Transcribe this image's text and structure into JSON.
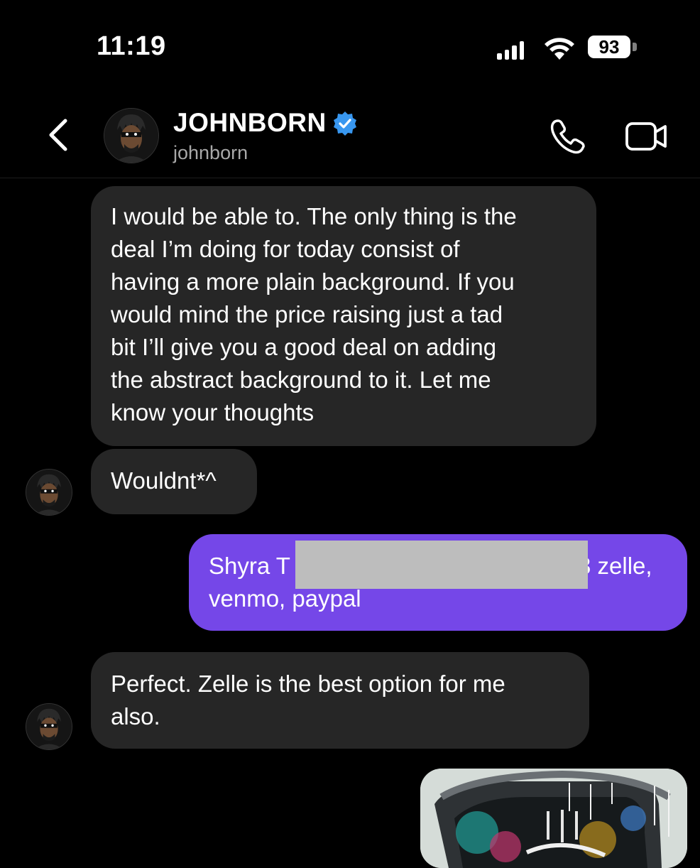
{
  "status_bar": {
    "time": "11:19",
    "battery": "93"
  },
  "header": {
    "name": "JOHNBORN",
    "handle": "johnborn",
    "icons": [
      "chevron-left-icon",
      "verified-badge-icon",
      "phone-icon",
      "video-camera-icon"
    ]
  },
  "messages": [
    {
      "from": "johnborn",
      "text": "I would be able to. The only thing is the\ndeal I’m doing for today consist of\nhaving a more plain background. If you\nwould mind the price raising just a tad\nbit I’ll give you a good deal on adding\nthe abstract background to it. Let me\nknow your thoughts"
    },
    {
      "from": "johnborn",
      "text": "Wouldnt*^"
    },
    {
      "from": "me",
      "text_start": "Shyra T",
      "text_end": "3 zelle,",
      "text_line2": "venmo, paypal"
    },
    {
      "from": "johnborn",
      "text": "Perfect. Zelle is the best option for me\nalso."
    }
  ],
  "colors": {
    "background": "#000000",
    "incoming_bubble": "#262626",
    "outgoing_bubble": "#7547e8",
    "verified": "#3897f0",
    "handle_text": "#a8a8a8",
    "redaction": "#bdbdbd"
  }
}
